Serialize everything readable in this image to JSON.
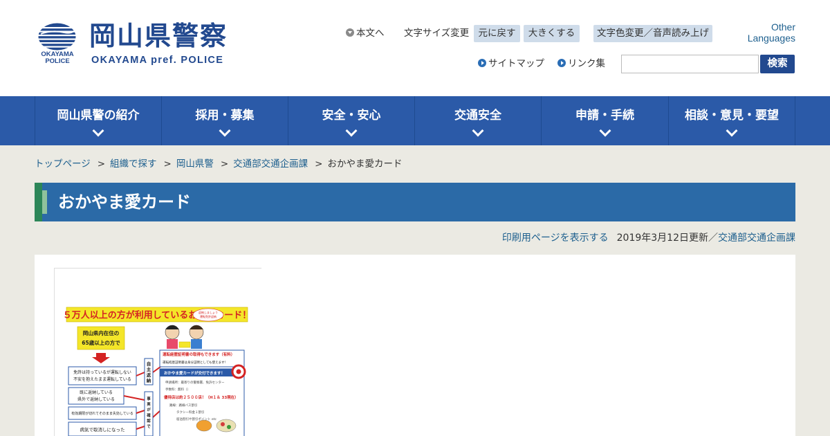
{
  "logo": {
    "emblem_text_line1": "OKAYAMA",
    "emblem_text_line2": "POLICE",
    "title": "岡山県警察",
    "subtitle": "OKAYAMA pref. POLICE"
  },
  "utility": {
    "skip_link": "本文へ",
    "font_size_label": "文字サイズ変更",
    "font_reset": "元に戻す",
    "font_larger": "大きくする",
    "color_voice": "文字色変更／音声読み上げ",
    "other_languages_line1": "Other",
    "other_languages_line2": "Languages",
    "sitemap": "サイトマップ",
    "links": "リンク集"
  },
  "search": {
    "placeholder": "",
    "button": "検索"
  },
  "nav": {
    "items": [
      {
        "label": "岡山県警の紹介"
      },
      {
        "label": "採用・募集"
      },
      {
        "label": "安全・安心"
      },
      {
        "label": "交通安全"
      },
      {
        "label": "申請・手続"
      },
      {
        "label": "相談・意見・要望"
      }
    ]
  },
  "breadcrumb": {
    "items": [
      "トップページ",
      "組織で探す",
      "岡山県警",
      "交通部交通企画課"
    ],
    "separator": ">",
    "current": "おかやま愛カード"
  },
  "page": {
    "title": "おかやま愛カード",
    "print_link": "印刷用ページを表示する",
    "updated": "2019年3月12日更新／",
    "department": "交通部交通企画課"
  },
  "flyer": {
    "headline": "５万人以上の方が利用しているお得なカード！",
    "target": "岡山県内在住の\n65歳以上の方で",
    "conditions": [
      "免許は持っているが運転しない\n不安を抱えたまま運転している",
      "既に返納している\n県外で返納している",
      "有効期限が切れてそのまま失効している",
      "病気で取消しになった"
    ],
    "side_label_1": "自主返納",
    "side_label_2": "事実が確認できる",
    "bubble": "運転経歴証明書の取得もできます（有料）",
    "bubble_sub": "運転経歴証明書は身分証明としても使えます！",
    "card_heading": "おかやま愛カードが交付できます！",
    "card_lines": [
      "申請場所：最寄りの警察署、免許センター",
      "手数料：無料（）"
    ],
    "discount": "優待店は約２５００店！（H１＆ 33現在）",
    "discount_lines": [
      "路線：路線バス割引",
      "タクシー料金１割引",
      "宿泊割引や割引ポイント etc"
    ],
    "bubble_top": "返納しましょう 運転免許返納"
  },
  "colors": {
    "brand": "#22498f",
    "nav_bg": "#2b5aa8",
    "title_bg": "#2b6aa7",
    "title_accent": "#2c8658",
    "link": "#1d5f8e",
    "page_bg": "#ebeae3"
  }
}
